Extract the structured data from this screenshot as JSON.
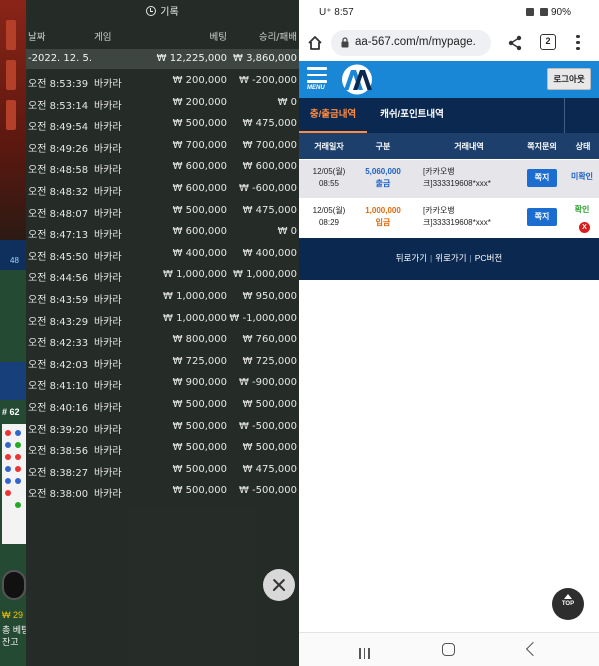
{
  "left_panel": {
    "title": "기록",
    "side": {
      "channel": "48",
      "game_no": "# 62",
      "balance_amount": "₩ 29",
      "bet_label": "총 베팅",
      "balance_label": "잔고"
    },
    "columns": {
      "date": "날짜",
      "game": "게임",
      "bet": "베팅",
      "win_loss": "승리/패배"
    },
    "total": {
      "date": "-2022. 12. 5.",
      "bet": "₩ 12,225,000",
      "win_loss": "₩ 3,860,000"
    },
    "rows": [
      {
        "time": "오전 8:53:39",
        "game": "바카라",
        "bet": "₩ 200,000",
        "result": "₩ -200,000"
      },
      {
        "time": "오전 8:53:14",
        "game": "바카라",
        "bet": "₩ 200,000",
        "result": "₩ 0"
      },
      {
        "time": "오전 8:49:54",
        "game": "바카라",
        "bet": "₩ 500,000",
        "result": "₩ 475,000"
      },
      {
        "time": "오전 8:49:26",
        "game": "바카라",
        "bet": "₩ 700,000",
        "result": "₩ 700,000"
      },
      {
        "time": "오전 8:48:58",
        "game": "바카라",
        "bet": "₩ 600,000",
        "result": "₩ 600,000"
      },
      {
        "time": "오전 8:48:32",
        "game": "바카라",
        "bet": "₩ 600,000",
        "result": "₩ -600,000"
      },
      {
        "time": "오전 8:48:07",
        "game": "바카라",
        "bet": "₩ 500,000",
        "result": "₩ 475,000"
      },
      {
        "time": "오전 8:47:13",
        "game": "바카라",
        "bet": "₩ 600,000",
        "result": "₩ 0"
      },
      {
        "time": "오전 8:45:50",
        "game": "바카라",
        "bet": "₩ 400,000",
        "result": "₩ 400,000"
      },
      {
        "time": "오전 8:44:56",
        "game": "바카라",
        "bet": "₩ 1,000,000",
        "result": "₩ 1,000,000"
      },
      {
        "time": "오전 8:43:59",
        "game": "바카라",
        "bet": "₩ 1,000,000",
        "result": "₩ 950,000"
      },
      {
        "time": "오전 8:43:29",
        "game": "바카라",
        "bet": "₩ 1,000,000",
        "result": "₩ -1,000,000"
      },
      {
        "time": "오전 8:42:33",
        "game": "바카라",
        "bet": "₩ 800,000",
        "result": "₩ 760,000"
      },
      {
        "time": "오전 8:42:03",
        "game": "바카라",
        "bet": "₩ 725,000",
        "result": "₩ 725,000"
      },
      {
        "time": "오전 8:41:10",
        "game": "바카라",
        "bet": "₩ 900,000",
        "result": "₩ -900,000"
      },
      {
        "time": "오전 8:40:16",
        "game": "바카라",
        "bet": "₩ 500,000",
        "result": "₩ 500,000"
      },
      {
        "time": "오전 8:39:20",
        "game": "바카라",
        "bet": "₩ 500,000",
        "result": "₩ -500,000"
      },
      {
        "time": "오전 8:38:56",
        "game": "바카라",
        "bet": "₩ 500,000",
        "result": "₩ 500,000"
      },
      {
        "time": "오전 8:38:27",
        "game": "바카라",
        "bet": "₩ 500,000",
        "result": "₩ 475,000"
      },
      {
        "time": "오전 8:38:00",
        "game": "바카라",
        "bet": "₩ 500,000",
        "result": "₩ -500,000"
      }
    ]
  },
  "right_panel": {
    "status_bar": {
      "left": "U⁺ 8:57",
      "battery": "90%"
    },
    "browser": {
      "url": "aa-567.com/m/mypage.",
      "tab_count": "2"
    },
    "site": {
      "menu_label": "MENU",
      "logout_label": "로그아웃",
      "tabs": {
        "deposit": "충/출금내역",
        "cash": "캐쉬/포인트내역"
      },
      "table_headers": [
        "거래일자",
        "구분",
        "거래내역",
        "쪽지문의",
        "상태"
      ],
      "rows": [
        {
          "date_line1": "12/05(월)",
          "date_line2": "08:55",
          "amount": "5,060,000",
          "type": "출금",
          "detail": "[카카오뱅크]333319608*xxx*",
          "note_btn": "쪽지",
          "status": "미확인"
        },
        {
          "date_line1": "12/05(월)",
          "date_line2": "08:29",
          "amount": "1,000,000",
          "type": "입금",
          "detail": "[카카오뱅크]333319608*xxx*",
          "note_btn": "쪽지",
          "status": "확인",
          "status_mark": "X"
        }
      ],
      "footer": {
        "back": "뒤로가기",
        "up": "위로가기",
        "pc": "PC버전"
      },
      "top_label": "TOP"
    },
    "colors": {
      "brand_blue": "#1a86d6",
      "navy": "#0b2850",
      "accent_orange": "#ff8c40",
      "withdraw_blue": "#1c60c4",
      "deposit_orange": "#e06a0a"
    }
  }
}
